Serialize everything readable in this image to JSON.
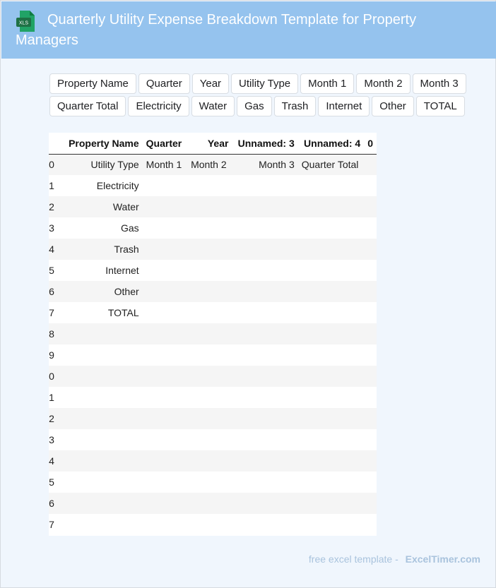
{
  "header": {
    "title": "Quarterly Utility Expense Breakdown Template for Property Managers",
    "icon_label": "XLS"
  },
  "chips": {
    "row1": [
      "Property Name",
      "Quarter",
      "Year",
      "Utility Type",
      "Month 1",
      "Month 2",
      "Month 3"
    ],
    "row2": [
      "Quarter Total",
      "Electricity",
      "Water",
      "Gas",
      "Trash",
      "Internet",
      "Other",
      "TOTAL"
    ]
  },
  "table": {
    "columns": [
      "",
      "Property Name",
      "Quarter",
      "Year",
      "Unnamed: 3",
      "Unnamed: 4",
      "0"
    ],
    "rows": [
      [
        "0",
        "Utility Type",
        "Month 1",
        "Month 2",
        "Month 3",
        "Quarter Total",
        ""
      ],
      [
        "1",
        "Electricity",
        "",
        "",
        "",
        "",
        ""
      ],
      [
        "2",
        "Water",
        "",
        "",
        "",
        "",
        ""
      ],
      [
        "3",
        "Gas",
        "",
        "",
        "",
        "",
        ""
      ],
      [
        "4",
        "Trash",
        "",
        "",
        "",
        "",
        ""
      ],
      [
        "5",
        "Internet",
        "",
        "",
        "",
        "",
        ""
      ],
      [
        "6",
        "Other",
        "",
        "",
        "",
        "",
        ""
      ],
      [
        "7",
        "TOTAL",
        "",
        "",
        "",
        "",
        ""
      ],
      [
        "8",
        "",
        "",
        "",
        "",
        "",
        ""
      ],
      [
        "9",
        "",
        "",
        "",
        "",
        "",
        ""
      ],
      [
        "0",
        "",
        "",
        "",
        "",
        "",
        ""
      ],
      [
        "1",
        "",
        "",
        "",
        "",
        "",
        ""
      ],
      [
        "2",
        "",
        "",
        "",
        "",
        "",
        ""
      ],
      [
        "3",
        "",
        "",
        "",
        "",
        "",
        ""
      ],
      [
        "4",
        "",
        "",
        "",
        "",
        "",
        ""
      ],
      [
        "5",
        "",
        "",
        "",
        "",
        "",
        ""
      ],
      [
        "6",
        "",
        "",
        "",
        "",
        "",
        ""
      ],
      [
        "7",
        "",
        "",
        "",
        "",
        "",
        ""
      ]
    ]
  },
  "footer": {
    "prefix": "free excel template -",
    "brand": "ExcelTimer.com"
  },
  "colors": {
    "header_bg": "#95c3ee",
    "page_bg": "#f0f6fd",
    "icon_green": "#1e7145"
  }
}
